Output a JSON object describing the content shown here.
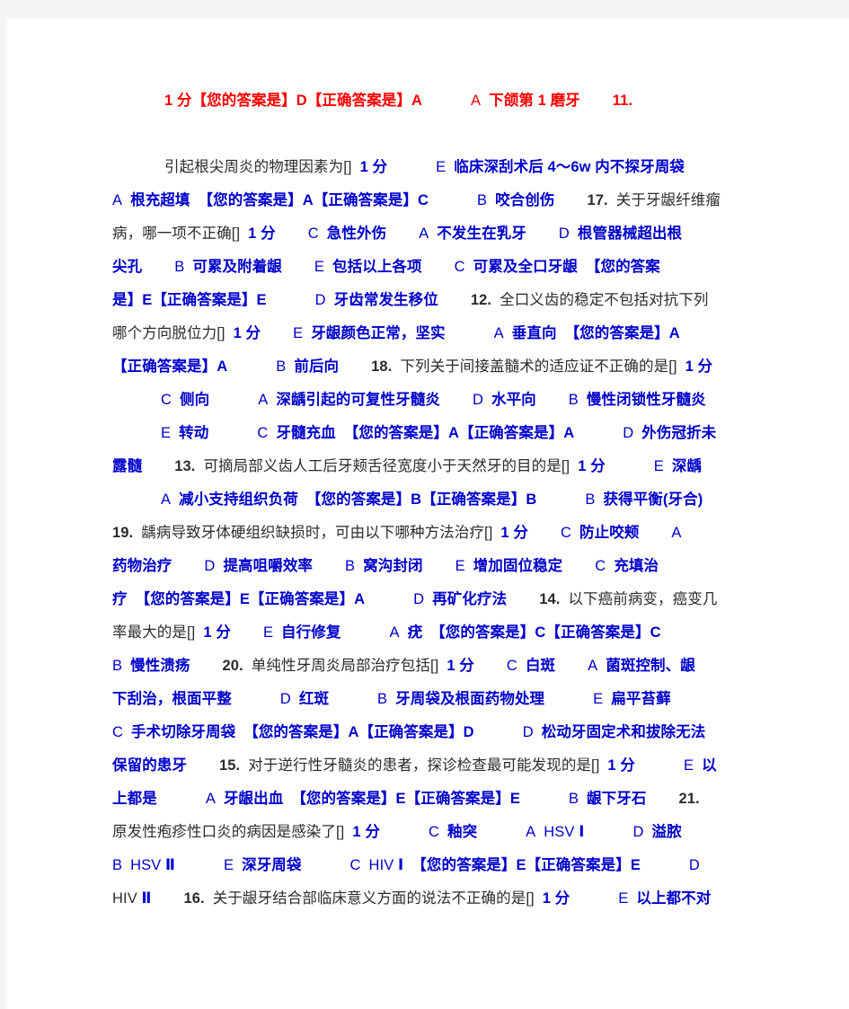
{
  "document": {
    "type": "exam-answer-sheet",
    "subject_hint": "口腔医学试题答案",
    "colors": {
      "page_background": "#ffffff",
      "canvas_background": "#f4f4f4",
      "correct_red": "#ff0000",
      "option_blue": "#0000cc",
      "question_black": "#2b2b2b"
    },
    "labels": {
      "score": "1 分",
      "your_answer": "【您的答案是】",
      "correct_answer": "【正确答案是】",
      "bracket_blank": "[]"
    }
  },
  "lines": {
    "l1": {
      "score": "1 分",
      "your_answer": "【您的答案是】",
      "your_value": "D",
      "correct_answer": "【正确答案是】",
      "correct_value": "A",
      "opt_letter": "A",
      "opt_text": "下颌第 1 磨牙",
      "next_num": "11."
    },
    "l2": {
      "question": "引起根尖周炎的物理因素为[]",
      "score": "1 分",
      "opt_letter": "E",
      "opt_text": "临床深刮术后 4～6w 内不探牙周袋"
    },
    "l3": {
      "opt_letter": "A",
      "opt_text": "根充超填",
      "your_answer": "【您的答案是】",
      "your_value": "A",
      "correct_answer": "【正确答案是】",
      "correct_value": "C",
      "opt2_letter": "B",
      "opt2_text": "咬合创伤",
      "num": "17.",
      "q_head": "关于牙龈纤维瘤"
    },
    "l4": {
      "q_tail": "病，哪一项不正确[]",
      "score": "1 分",
      "opt_letter": "C",
      "opt_text": "急性外伤",
      "opt2_letter": "A",
      "opt2_text": "不发生在乳牙",
      "opt3_letter": "D",
      "opt3_text": "根管器械超出根"
    },
    "l5": {
      "cont": "尖孔",
      "opt_letter": "B",
      "opt_text": "可累及附着龈",
      "opt2_letter": "E",
      "opt2_text": "包括以上各项",
      "opt3_letter": "C",
      "opt3_text": "可累及全口牙龈",
      "your_answer_head": "【您的答案"
    },
    "l6": {
      "your_answer_tail": "是】",
      "your_value": "E",
      "correct_answer": "【正确答案是】",
      "correct_value": "E",
      "opt_letter": "D",
      "opt_text": "牙齿常发生移位",
      "num": "12.",
      "q_head": "全口义齿的稳定不包括对抗下列"
    },
    "l7": {
      "q_tail": "哪个方向脱位力[]",
      "score": "1 分",
      "opt_letter": "E",
      "opt_text": "牙龈颜色正常，坚实",
      "opt2_letter": "A",
      "opt2_text": "垂直向",
      "your_answer": "【您的答案是】",
      "your_value": "A"
    },
    "l8": {
      "correct_answer": "【正确答案是】",
      "correct_value": "A",
      "opt_letter": "B",
      "opt_text": "前后向",
      "num": "18.",
      "q": "下列关于间接盖髓术的适应证不正确的是[]",
      "score": "1 分"
    },
    "l9": {
      "opt_letter": "C",
      "opt_text": "侧向",
      "opt2_letter": "A",
      "opt2_text": "深龋引起的可复性牙髓炎",
      "opt3_letter": "D",
      "opt3_text": "水平向",
      "opt4_letter": "B",
      "opt4_text": "慢性闭锁性牙髓炎"
    },
    "l10": {
      "opt_letter": "E",
      "opt_text": "转动",
      "opt2_letter": "C",
      "opt2_text": "牙髓充血",
      "your_answer": "【您的答案是】",
      "your_value": "A",
      "correct_answer": "【正确答案是】",
      "correct_value": "A",
      "opt3_letter": "D",
      "opt3_text": "外伤冠折未"
    },
    "l11": {
      "cont": "露髓",
      "num": "13.",
      "q": "可摘局部义齿人工后牙颊舌径宽度小于天然牙的目的是[]",
      "score": "1 分",
      "opt_letter": "E",
      "opt_text": "深龋"
    },
    "l12": {
      "opt_letter": "A",
      "opt_text": "减小支持组织负荷",
      "your_answer": "【您的答案是】",
      "your_value": "B",
      "correct_answer": "【正确答案是】",
      "correct_value": "B",
      "opt2_letter": "B",
      "opt2_text": "获得平衡(牙合)"
    },
    "l13": {
      "num": "19.",
      "q": "龋病导致牙体硬组织缺损时，可由以下哪种方法治疗[]",
      "score": "1 分",
      "opt_letter": "C",
      "opt_text": "防止咬颊",
      "opt2_letter": "A"
    },
    "l14": {
      "opt_text": "药物治疗",
      "opt2_letter": "D",
      "opt2_text": "提高咀嚼效率",
      "opt3_letter": "B",
      "opt3_text": "窝沟封闭",
      "opt4_letter": "E",
      "opt4_text": "增加固位稳定",
      "opt5_letter": "C",
      "opt5_text": "充填治"
    },
    "l15": {
      "cont": "疗",
      "your_answer": "【您的答案是】",
      "your_value": "E",
      "correct_answer": "【正确答案是】",
      "correct_value": "A",
      "opt_letter": "D",
      "opt_text": "再矿化疗法",
      "num": "14.",
      "q_head": "以下癌前病变，癌变几"
    },
    "l16": {
      "q_tail": "率最大的是[]",
      "score": "1 分",
      "opt_letter": "E",
      "opt_text": "自行修复",
      "opt2_letter": "A",
      "opt2_text": "疣",
      "your_answer": "【您的答案是】",
      "your_value": "C",
      "correct_answer": "【正确答案是】",
      "correct_value": "C"
    },
    "l17": {
      "opt_letter": "B",
      "opt_text": "慢性溃疡",
      "num": "20.",
      "q": "单纯性牙周炎局部治疗包括[]",
      "score": "1 分",
      "opt2_letter": "C",
      "opt2_text": "白斑",
      "opt3_letter": "A",
      "opt3_text": "菌斑控制、龈"
    },
    "l18": {
      "cont": "下刮治，根面平整",
      "opt_letter": "D",
      "opt_text": "红斑",
      "opt2_letter": "B",
      "opt2_text": "牙周袋及根面药物处理",
      "opt3_letter": "E",
      "opt3_text": "扁平苔藓"
    },
    "l19": {
      "opt_letter": "C",
      "opt_text": "手术切除牙周袋",
      "your_answer": "【您的答案是】",
      "your_value": "A",
      "correct_answer": "【正确答案是】",
      "correct_value": "D",
      "opt2_letter": "D",
      "opt2_text": "松动牙固定术和拔除无法"
    },
    "l20": {
      "cont": "保留的患牙",
      "num": "15.",
      "q": "对于逆行性牙髓炎的患者，探诊检查最可能发现的是[]",
      "score": "1 分",
      "opt_letter": "E",
      "opt_text": "以"
    },
    "l21": {
      "cont": "上都是",
      "opt_letter": "A",
      "opt_text": "牙龈出血",
      "your_answer": "【您的答案是】",
      "your_value": "E",
      "correct_answer": "【正确答案是】",
      "correct_value": "E",
      "opt2_letter": "B",
      "opt2_text": "龈下牙石",
      "num": "21."
    },
    "l22": {
      "q": "原发性疱疹性口炎的病因是感染了[]",
      "score": "1 分",
      "opt_letter": "C",
      "opt_text": "釉突",
      "opt2_letter": "A",
      "opt2_text": "HSV ",
      "opt2_roman": "Ⅰ",
      "opt3_letter": "D",
      "opt3_text": "溢脓"
    },
    "l23": {
      "opt_letter": "B",
      "opt_text": "HSV ",
      "opt_roman": "Ⅱ",
      "opt2_letter": "E",
      "opt2_text": "深牙周袋",
      "opt3_letter": "C",
      "opt3_text": "HIV ",
      "opt3_roman": "Ⅰ",
      "your_answer": "【您的答案是】",
      "your_value": "E",
      "correct_answer": "【正确答案是】",
      "correct_value": "E",
      "opt4_letter": "D"
    },
    "l24": {
      "cont": "HIV ",
      "cont_roman": "Ⅱ",
      "num": "16.",
      "q": "关于龈牙结合部临床意义方面的说法不正确的是[]",
      "score": "1 分",
      "opt_letter": "E",
      "opt_text": "以上都不对"
    }
  }
}
